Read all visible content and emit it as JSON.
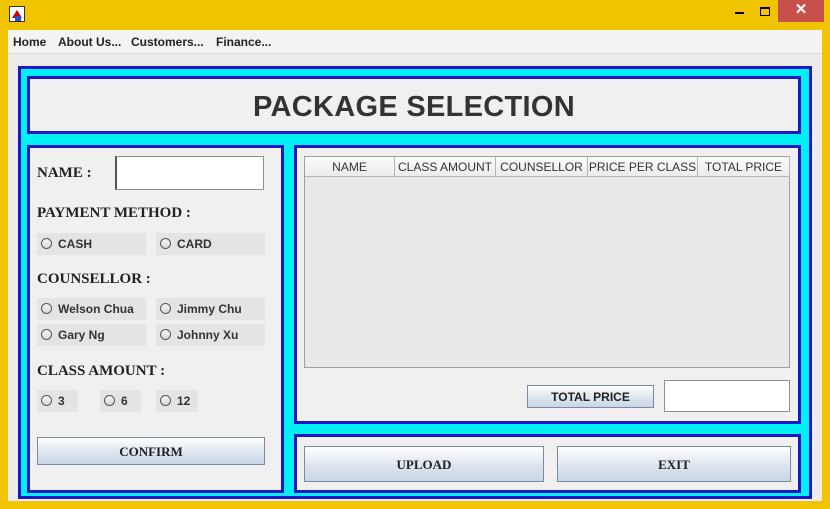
{
  "window": {
    "app_icon": "java-app-icon",
    "controls": {
      "minimize": "minimize-icon",
      "maximize": "maximize-icon",
      "close": "✕"
    }
  },
  "menu": {
    "items": [
      "Home",
      "About Us...",
      "Customers...",
      "Finance..."
    ]
  },
  "title": "PACKAGE SELECTION",
  "form": {
    "name_label": "NAME :",
    "name_value": "",
    "payment_label": "PAYMENT METHOD :",
    "payment_options": [
      "CASH",
      "CARD"
    ],
    "counsellor_label": "COUNSELLOR :",
    "counsellor_options": [
      "Welson Chua",
      "Jimmy Chu",
      "Gary Ng",
      "Johnny Xu"
    ],
    "class_amount_label": "CLASS AMOUNT :",
    "class_amount_options": [
      "3",
      "6",
      "12"
    ],
    "confirm_label": "CONFIRM"
  },
  "table": {
    "columns": [
      "NAME",
      "CLASS AMOUNT",
      "COUNSELLOR",
      "PRICE PER CLASS",
      "TOTAL PRICE"
    ],
    "rows": []
  },
  "total": {
    "button_label": "TOTAL PRICE",
    "value": ""
  },
  "actions": {
    "upload_label": "UPLOAD",
    "exit_label": "EXIT"
  },
  "colors": {
    "frame": "#f0c400",
    "accent_border": "#1818c8",
    "cyan_background": "#00f0f6",
    "close_button": "#c7504a"
  }
}
